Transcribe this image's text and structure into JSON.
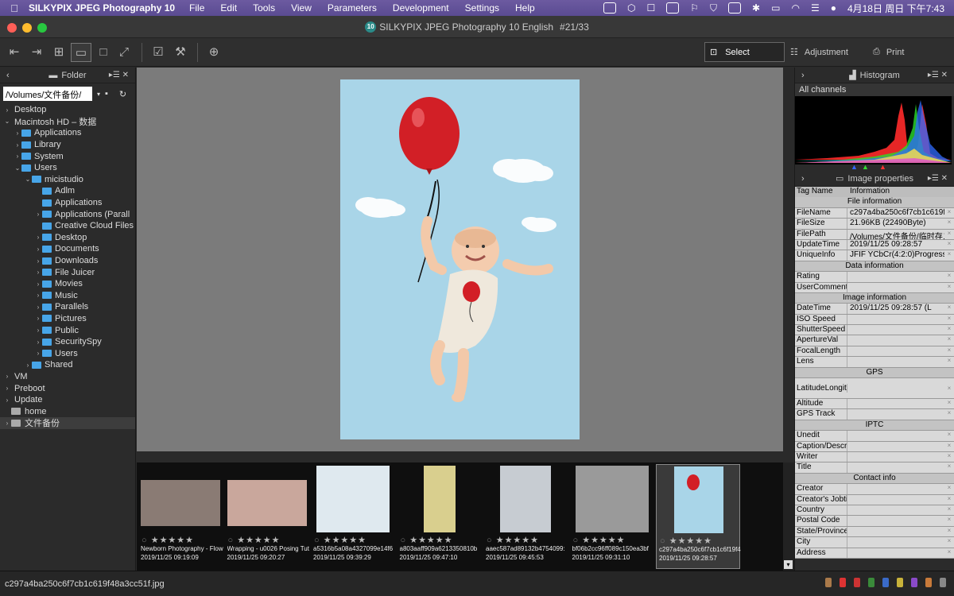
{
  "menubar": {
    "app_name": "SILKYPIX JPEG Photography 10",
    "items": [
      "File",
      "Edit",
      "Tools",
      "View",
      "Parameters",
      "Development",
      "Settings",
      "Help"
    ],
    "clock": "4月18日 周日 下午7:43"
  },
  "window": {
    "badge": "10",
    "title": "SILKYPIX JPEG Photography 10 English",
    "position": "#21/33"
  },
  "toolbar": {
    "select_label": "Select",
    "adjustment_label": "Adjustment",
    "print_label": "Print"
  },
  "folder_panel": {
    "title": "Folder",
    "path": "/Volumes/文件备份/",
    "tree": [
      {
        "label": "Desktop",
        "depth": 0,
        "arrow": "›",
        "icon": "none"
      },
      {
        "label": "Macintosh HD – 数据",
        "depth": 0,
        "arrow": "⌄",
        "icon": "none"
      },
      {
        "label": "Applications",
        "depth": 1,
        "arrow": "›",
        "icon": "folder"
      },
      {
        "label": "Library",
        "depth": 1,
        "arrow": "›",
        "icon": "folder"
      },
      {
        "label": "System",
        "depth": 1,
        "arrow": "›",
        "icon": "folder"
      },
      {
        "label": "Users",
        "depth": 1,
        "arrow": "⌄",
        "icon": "folder"
      },
      {
        "label": "micistudio",
        "depth": 2,
        "arrow": "⌄",
        "icon": "folder"
      },
      {
        "label": "Adlm",
        "depth": 3,
        "arrow": "",
        "icon": "folder"
      },
      {
        "label": "Applications",
        "depth": 3,
        "arrow": "",
        "icon": "folder"
      },
      {
        "label": "Applications (Parall",
        "depth": 3,
        "arrow": "›",
        "icon": "folder"
      },
      {
        "label": "Creative Cloud Files",
        "depth": 3,
        "arrow": "",
        "icon": "folder"
      },
      {
        "label": "Desktop",
        "depth": 3,
        "arrow": "›",
        "icon": "folder"
      },
      {
        "label": "Documents",
        "depth": 3,
        "arrow": "›",
        "icon": "folder"
      },
      {
        "label": "Downloads",
        "depth": 3,
        "arrow": "›",
        "icon": "folder"
      },
      {
        "label": "File Juicer",
        "depth": 3,
        "arrow": "›",
        "icon": "folder"
      },
      {
        "label": "Movies",
        "depth": 3,
        "arrow": "›",
        "icon": "folder"
      },
      {
        "label": "Music",
        "depth": 3,
        "arrow": "›",
        "icon": "folder"
      },
      {
        "label": "Parallels",
        "depth": 3,
        "arrow": "›",
        "icon": "folder"
      },
      {
        "label": "Pictures",
        "depth": 3,
        "arrow": "›",
        "icon": "folder"
      },
      {
        "label": "Public",
        "depth": 3,
        "arrow": "›",
        "icon": "folder"
      },
      {
        "label": "SecuritySpy",
        "depth": 3,
        "arrow": "›",
        "icon": "folder"
      },
      {
        "label": "Users",
        "depth": 3,
        "arrow": "›",
        "icon": "folder"
      },
      {
        "label": "Shared",
        "depth": 2,
        "arrow": "›",
        "icon": "folder"
      },
      {
        "label": "VM",
        "depth": 0,
        "arrow": "›",
        "icon": "none"
      },
      {
        "label": "Preboot",
        "depth": 0,
        "arrow": "›",
        "icon": "none"
      },
      {
        "label": "Update",
        "depth": 0,
        "arrow": "›",
        "icon": "none"
      },
      {
        "label": "home",
        "depth": 0,
        "arrow": "",
        "icon": "disk"
      },
      {
        "label": "文件备份",
        "depth": 0,
        "arrow": "›",
        "icon": "disk",
        "selected": true
      }
    ]
  },
  "filmstrip": [
    {
      "name": "Newborn Photography - Flow",
      "date": "2019/11/25 09:19:09",
      "tone": "#8a7b74"
    },
    {
      "name": "Wrapping - u0026 Posing Tut",
      "date": "2019/11/25 09:20:27",
      "tone": "#c9a79c"
    },
    {
      "name": "a5316b5a08a4327099e14f6",
      "date": "2019/11/25 09:39:29",
      "tone": "#dfe9ef"
    },
    {
      "name": "a803aaff909a6213350810b",
      "date": "2019/11/25 09:47:10",
      "tone": "#d9cf8e"
    },
    {
      "name": "aaec587ad89132b4754099:",
      "date": "2019/11/25 09:45:53",
      "tone": "#c7ccd2"
    },
    {
      "name": "bf06b2cc96ff089c150ea3bf",
      "date": "2019/11/25 09:31:10",
      "tone": "#9a9a9a"
    },
    {
      "name": "c297a4ba250c6f7cb1c6f19f4",
      "date": "2019/11/25 09:28:57",
      "tone": "#a9d5e8",
      "selected": true
    }
  ],
  "histogram": {
    "title": "Histogram",
    "channel": "All channels"
  },
  "properties": {
    "title": "Image properties",
    "col_tag": "Tag Name",
    "col_info": "Information",
    "rows": [
      {
        "section": "File information"
      },
      {
        "k": "FileName",
        "v": "c297a4ba250c6f7cb1c619f"
      },
      {
        "k": "FileSize",
        "v": "21.96KB (22490Byte)"
      },
      {
        "k": "FilePath",
        "v": "/Volumes/文件备份/临时存ス"
      },
      {
        "k": "UpdateTime",
        "v": "2019/11/25 09:28:57"
      },
      {
        "k": "UniqueInfo",
        "v": "JFIF YCbCr(4:2:0)Progressiv"
      },
      {
        "section": "Data information"
      },
      {
        "k": "Rating",
        "v": ""
      },
      {
        "k": "UserComment",
        "v": ""
      },
      {
        "section": "Image information"
      },
      {
        "k": "DateTime",
        "v": "2019/11/25 09:28:57 (L"
      },
      {
        "k": "ISO Speed",
        "v": ""
      },
      {
        "k": "ShutterSpeed",
        "v": ""
      },
      {
        "k": "ApertureVal",
        "v": ""
      },
      {
        "k": "FocalLength",
        "v": ""
      },
      {
        "k": "Lens",
        "v": ""
      },
      {
        "section": "GPS"
      },
      {
        "k": "LatitudeLongit",
        "v": "",
        "tall": true
      },
      {
        "k": "Altitude",
        "v": ""
      },
      {
        "k": "GPS Track",
        "v": ""
      },
      {
        "section": "IPTC"
      },
      {
        "k": "Unedit",
        "v": ""
      },
      {
        "k": "Caption/Descr",
        "v": ""
      },
      {
        "k": "Writer",
        "v": ""
      },
      {
        "k": "Title",
        "v": ""
      },
      {
        "section": "Contact info"
      },
      {
        "k": "Creator",
        "v": ""
      },
      {
        "k": "Creator's Jobti",
        "v": ""
      },
      {
        "k": "Country",
        "v": ""
      },
      {
        "k": "Postal Code",
        "v": ""
      },
      {
        "k": "State/Province",
        "v": ""
      },
      {
        "k": "City",
        "v": ""
      },
      {
        "k": "Address",
        "v": ""
      }
    ]
  },
  "status": {
    "filename": "c297a4ba250c6f7cb1c619f48a3cc51f.jpg"
  },
  "colors": {
    "accent_blue": "#47a5e8",
    "balloon_red": "#d21f26",
    "photo_bg": "#a9d5e8"
  }
}
